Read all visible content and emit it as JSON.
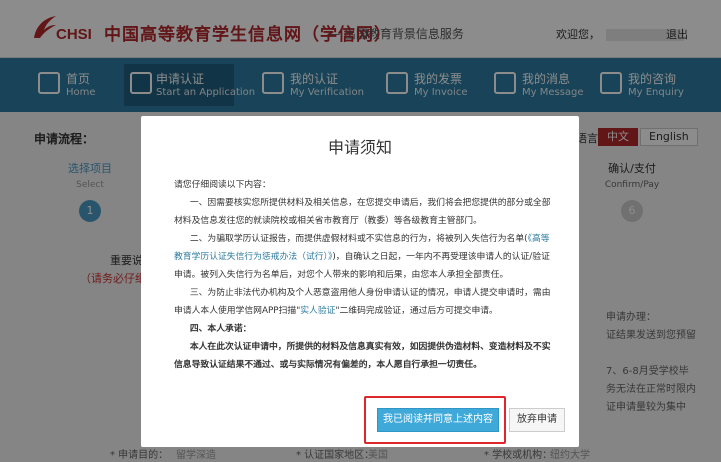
{
  "header": {
    "logo_text": "CHSI",
    "site_title": "中国高等教育学生信息网（学信网）",
    "site_subtitle": "— 出国教育背景信息服务",
    "welcome": "欢迎您，",
    "logout": "退出"
  },
  "nav": [
    {
      "cn": "首页",
      "en": "Home",
      "icon": "home-icon"
    },
    {
      "cn": "申请认证",
      "en": "Start an Application",
      "icon": "edit-icon"
    },
    {
      "cn": "我的认证",
      "en": "My Verification",
      "icon": "document-icon"
    },
    {
      "cn": "我的发票",
      "en": "My Invoice",
      "icon": "invoice-icon"
    },
    {
      "cn": "我的消息",
      "en": "My Message",
      "icon": "message-icon"
    },
    {
      "cn": "我的咨询",
      "en": "My Enquiry",
      "icon": "question-icon"
    }
  ],
  "page": {
    "flow_label": "申请流程：",
    "step1": {
      "cn": "选择项目",
      "en": "Select",
      "num": "1"
    },
    "step6": {
      "cn": "确认/支付",
      "en": "Confirm/Pay",
      "num": "6"
    },
    "lang_label": "语言：",
    "lang_zh": "中文",
    "lang_en": "English",
    "left_note": "重要说",
    "left_warn": "（请务必仔细阅",
    "right_lines": [
      "申请办理：",
      "证结果发送到您预留",
      "7、6-8月受学校毕",
      "务无法在正常时限内",
      "证申请量较为集中"
    ],
    "form_labels": [
      "* 申请目的：",
      "* 认证国家地区：",
      "* 学校或机构："
    ],
    "form_values": [
      "留学深造",
      "美国",
      "纽约大学"
    ]
  },
  "modal": {
    "title": "申请须知",
    "intro": "请您仔细阅读以下内容：",
    "p1": "一、因需要核实您所提供材料及相关信息，在您提交申请后，我们将会把您提供的部分或全部材料及信息发往您的就读院校或相关省市教育厅（教委）等各级教育主管部门。",
    "p2_a": "二、为骗取学历认证报告，而提供虚假材料或不实信息的行为，将被列入失信行为名单(",
    "p2_link": "《高等教育学历认证失信行为惩戒办法（试行）》",
    "p2_b": ")，自确认之日起，一年内不再受理该申请人的认证/验证申请。被列入失信行为名单后，对您个人带来的影响和后果，由您本人承担全部责任。",
    "p3_a": "三、为防止非法代办机构及个人恶意盗用他人身份申请认证的情况，申请人提交申请时，需由申请人本人使用学信网APP扫描\"",
    "p3_link": "实人验证",
    "p3_b": "\"二维码完成验证，通过后方可提交申请。",
    "p4_heading": "四、本人承诺：",
    "p4": "本人在此次认证申请中，所提供的材料及信息真实有效，如因提供伪造材料、变造材料及不实信息导致认证结果不通过、或与实际情况有偏差的，本人愿自行承担一切责任。",
    "agree_button": "我已阅读并同意上述内容",
    "giveup_button": "放弃申请"
  }
}
